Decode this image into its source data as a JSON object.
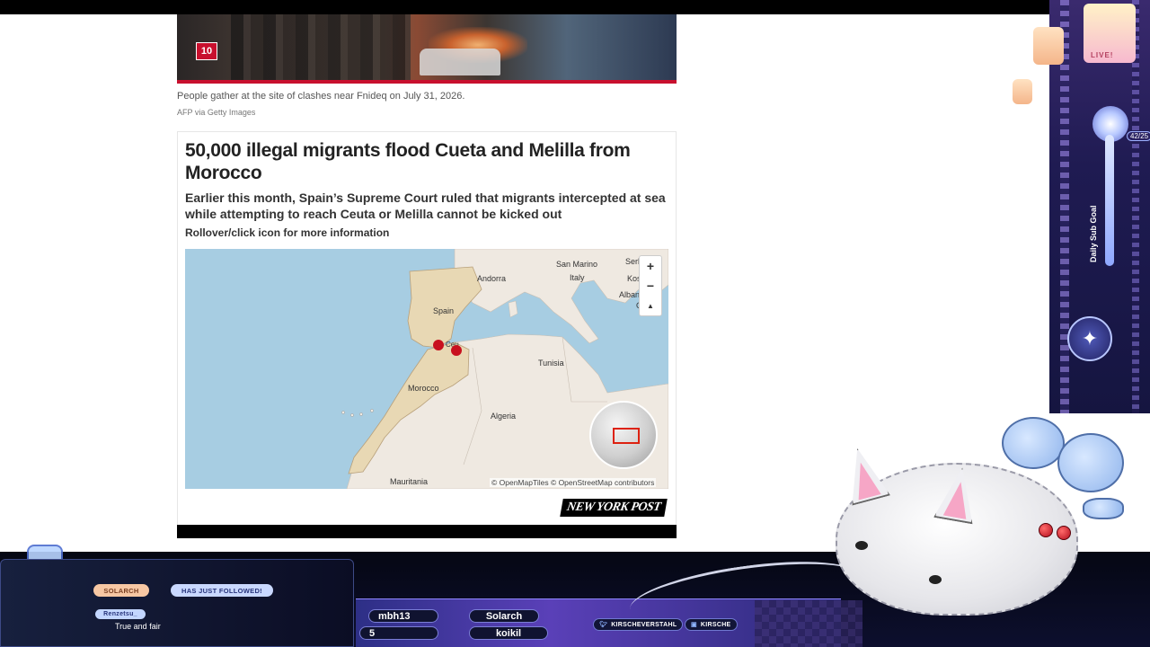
{
  "article": {
    "hero_badge": "10",
    "caption": "People gather at the site of clashes near Fnideq on July 31, 2026.",
    "credit": "AFP via Getty Images",
    "title": "50,000 illegal migrants flood Cueta and Melilla from Morocco",
    "subtitle": "Earlier this month, Spain’s Supreme Court ruled that migrants intercepted at sea while attempting to reach Ceuta or Melilla cannot be kicked out",
    "hint": "Rollover/click icon for more information",
    "brand": "NEW YORK POST"
  },
  "map": {
    "labels": {
      "san_marino": "San Marino",
      "serbia": "Serb",
      "andorra": "Andorra",
      "italy": "Italy",
      "kosovo": "Koso",
      "albania": "Albani",
      "greece": "G",
      "spain": "Spain",
      "ceuta": "Ceu",
      "tunisia": "Tunisia",
      "morocco": "Morocco",
      "algeria": "Algeria",
      "mauritania": "Mauritania"
    },
    "zoom_in": "+",
    "zoom_out": "−",
    "compass": "▲",
    "attribution": "© OpenMapTiles © OpenStreetMap contributors",
    "marker_color": "#c8101e"
  },
  "overlay": {
    "live": "LIVE!",
    "goal_count": "42/25",
    "goal_label": "Daily Sub Goal",
    "alert_user": "SOLARCH",
    "alert_text": "HAS JUST FOLLOWED!",
    "chat_user": "Renzetsu_",
    "chat_message": "True and fair",
    "slots": {
      "top_left": "mbh13",
      "top_right": "Solarch",
      "bottom_left": "5",
      "bottom_right": "koikil"
    },
    "socials": {
      "twitter": "KIRSCHEVERSTAHL",
      "discord": "KIRSCHE"
    }
  }
}
